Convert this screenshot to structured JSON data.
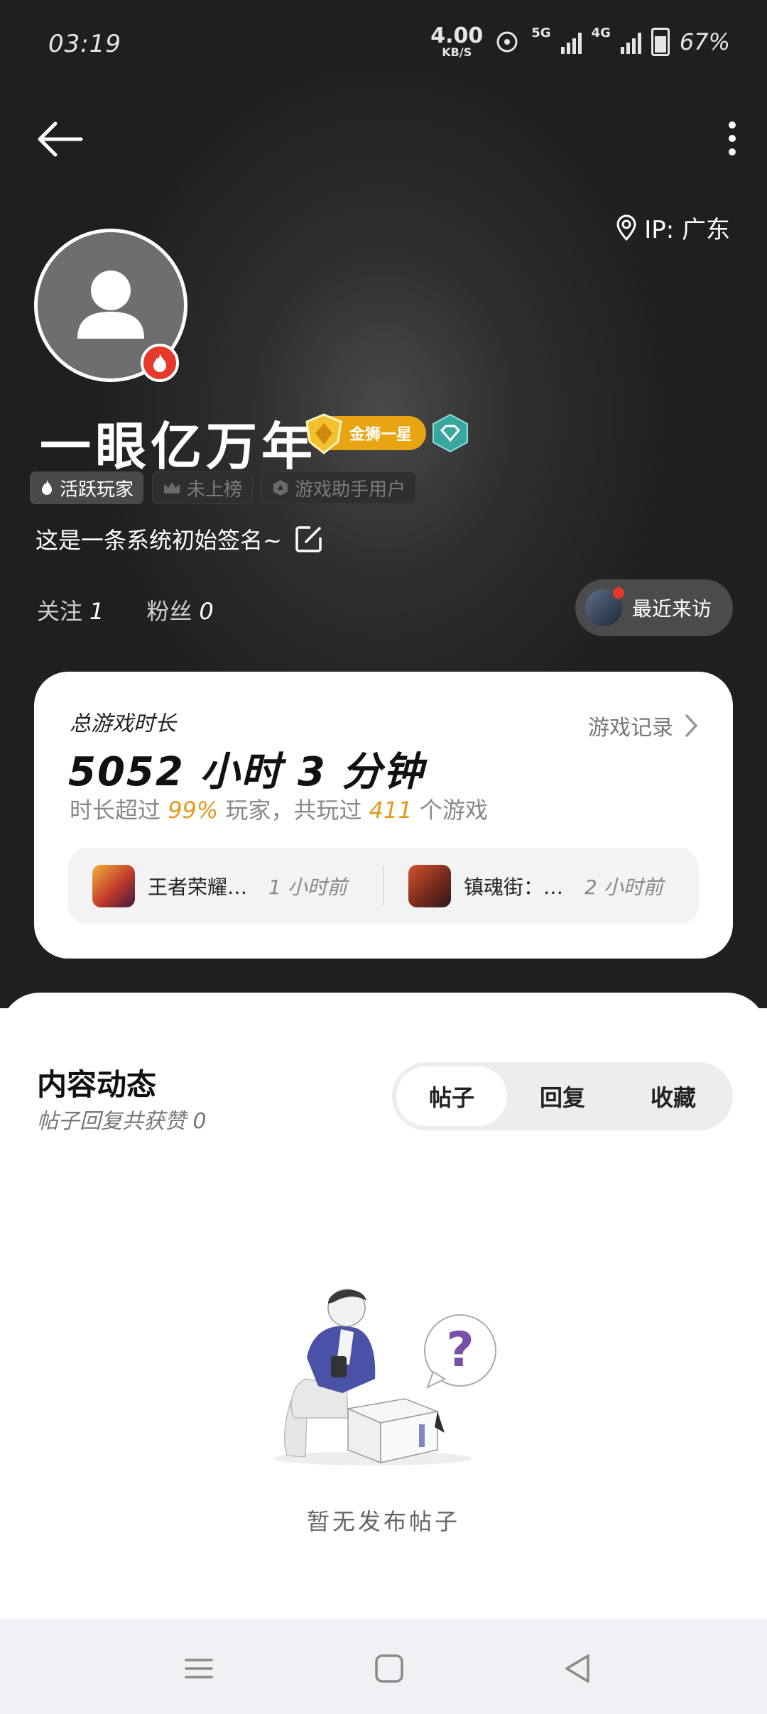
{
  "status_bar": {
    "time": "03:19",
    "net_speed": "4.00",
    "net_speed_unit": "KB/S",
    "network_5g": "5G",
    "network_4g": "4G",
    "battery": "67%",
    "battery_level": 0.67
  },
  "header": {
    "back_icon": "arrow-left-icon",
    "more_icon": "more-vertical-icon"
  },
  "profile": {
    "ip_location": "IP: 广东",
    "username": "一眼亿万年",
    "rank_label": "金狮一星",
    "tags": [
      {
        "label": "活跃玩家",
        "icon": "fire-icon"
      },
      {
        "label": "未上榜",
        "icon": "crown-icon"
      },
      {
        "label": "游戏助手用户",
        "icon": "hexagon-icon"
      }
    ],
    "signature": "这是一条系统初始签名~",
    "follow_label": "关注",
    "follow_count": "1",
    "fans_label": "粉丝",
    "fans_count": "0",
    "recent_visit_label": "最近来访"
  },
  "playtime": {
    "label": "总游戏时长",
    "record_link": "游戏记录",
    "value": "5052 小时 3 分钟",
    "sub_prefix": "时长超过",
    "percent": "99%",
    "sub_mid": "玩家，共玩过",
    "game_count": "411",
    "sub_suffix": "个游戏",
    "recent_games": [
      {
        "name": "王者荣耀…",
        "time": "1 小时前",
        "color": "#c23a2a"
      },
      {
        "name": "镇魂街：…",
        "time": "2 小时前",
        "color": "#7a2a1e"
      }
    ]
  },
  "content": {
    "title": "内容动态",
    "subtitle": "帖子回复共获赞 0",
    "tabs": [
      "帖子",
      "回复",
      "收藏"
    ],
    "active_tab": 0,
    "empty_text": "暂无发布帖子"
  },
  "colors": {
    "accent_orange": "#e39a1d",
    "badge_red": "#e5392b",
    "rank_gold": "#e9a412",
    "question_purple": "#7a4fa8"
  }
}
